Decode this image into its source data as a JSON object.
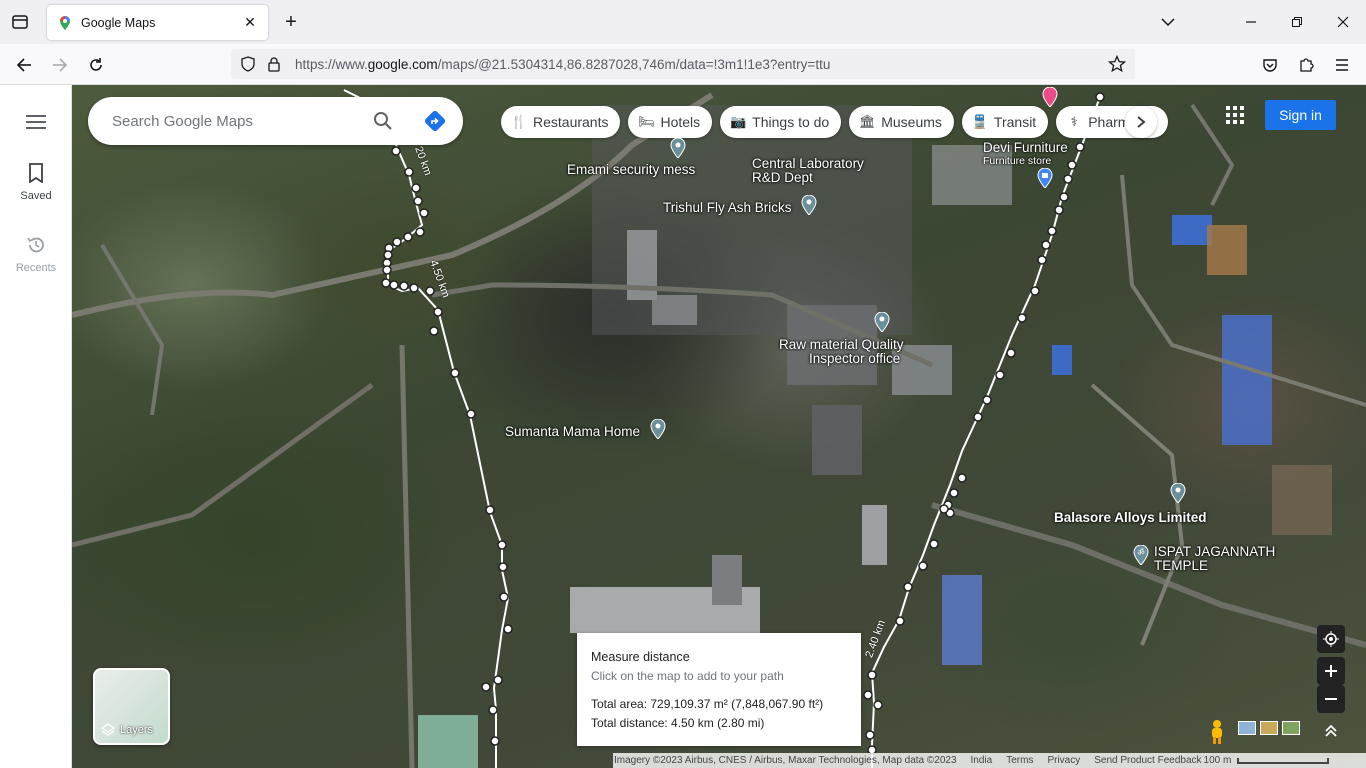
{
  "browser": {
    "tab_title": "Google Maps",
    "url_prefix": "https://www.",
    "url_domain": "google.com",
    "url_rest": "/maps/@21.5304314,86.8287028,746m/data=!3m1!1e3?entry=ttu"
  },
  "sidebar": {
    "saved_label": "Saved",
    "recents_label": "Recents"
  },
  "search": {
    "placeholder": "Search Google Maps"
  },
  "chips": [
    {
      "label": "Restaurants",
      "icon": "fork-knife-icon"
    },
    {
      "label": "Hotels",
      "icon": "bed-icon"
    },
    {
      "label": "Things to do",
      "icon": "camera-icon"
    },
    {
      "label": "Museums",
      "icon": "museum-icon"
    },
    {
      "label": "Transit",
      "icon": "train-icon"
    },
    {
      "label": "Pharmac",
      "icon": "pharmacy-icon"
    }
  ],
  "header": {
    "signin_label": "Sign in"
  },
  "places": {
    "emami": "Emami security mess",
    "central_lab_1": "Central Laboratory",
    "central_lab_2": "R&D Dept",
    "trishul": "Trishul Fly Ash Bricks",
    "devi": "Devi Furniture",
    "devi_sub": "Furniture store",
    "raw_1": "Raw material Quality",
    "raw_2": "Inspector office",
    "sumanta": "Sumanta Mama Home",
    "balasore": "Balasore Alloys Limited",
    "ispat_1": "ISPAT JAGANNATH",
    "ispat_2": "TEMPLE"
  },
  "route_labels": {
    "a": "20 km",
    "b": "4.50 km",
    "c": "2.40 km"
  },
  "measure": {
    "title": "Measure distance",
    "hint": "Click on the map to add to your path",
    "area": "Total area: 729,109.37 m² (7,848,067.90 ft²)",
    "distance": "Total distance: 4.50 km (2.80 mi)"
  },
  "layers": {
    "label": "Layers"
  },
  "attribution": {
    "imagery": "Imagery ©2023 Airbus, CNES / Airbus, Maxar Technologies, Map data ©2023",
    "country": "India",
    "terms": "Terms",
    "privacy": "Privacy",
    "feedback": "Send Product Feedback",
    "scale": "100 m"
  },
  "colors": {
    "accent": "#1a73e8",
    "route": "#ffffff",
    "pin_blue": "#4285f4",
    "pin_red": "#ea4335"
  }
}
